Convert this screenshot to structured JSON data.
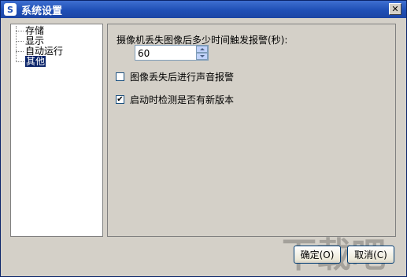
{
  "window": {
    "title": "系统设置",
    "title_icon": "S"
  },
  "tree": {
    "items": [
      {
        "label": "存储",
        "selected": false
      },
      {
        "label": "显示",
        "selected": false
      },
      {
        "label": "自动运行",
        "selected": false
      },
      {
        "label": "其他",
        "selected": true
      }
    ]
  },
  "settings": {
    "camera_lost_label": "摄像机丢失图像后多少时间触发报警(秒):",
    "camera_lost_seconds": "60",
    "sound_alarm_label": "图像丢失后进行声音报警",
    "sound_alarm_checked": false,
    "check_update_label": "启动时检测是否有新版本",
    "check_update_checked": true
  },
  "buttons": {
    "ok_label": "确定(O)",
    "cancel_label": "取消(C)"
  },
  "colors": {
    "title_bar": "#1f4fb6",
    "selection": "#0a246a",
    "dialog_bg": "#d4d0c8"
  }
}
